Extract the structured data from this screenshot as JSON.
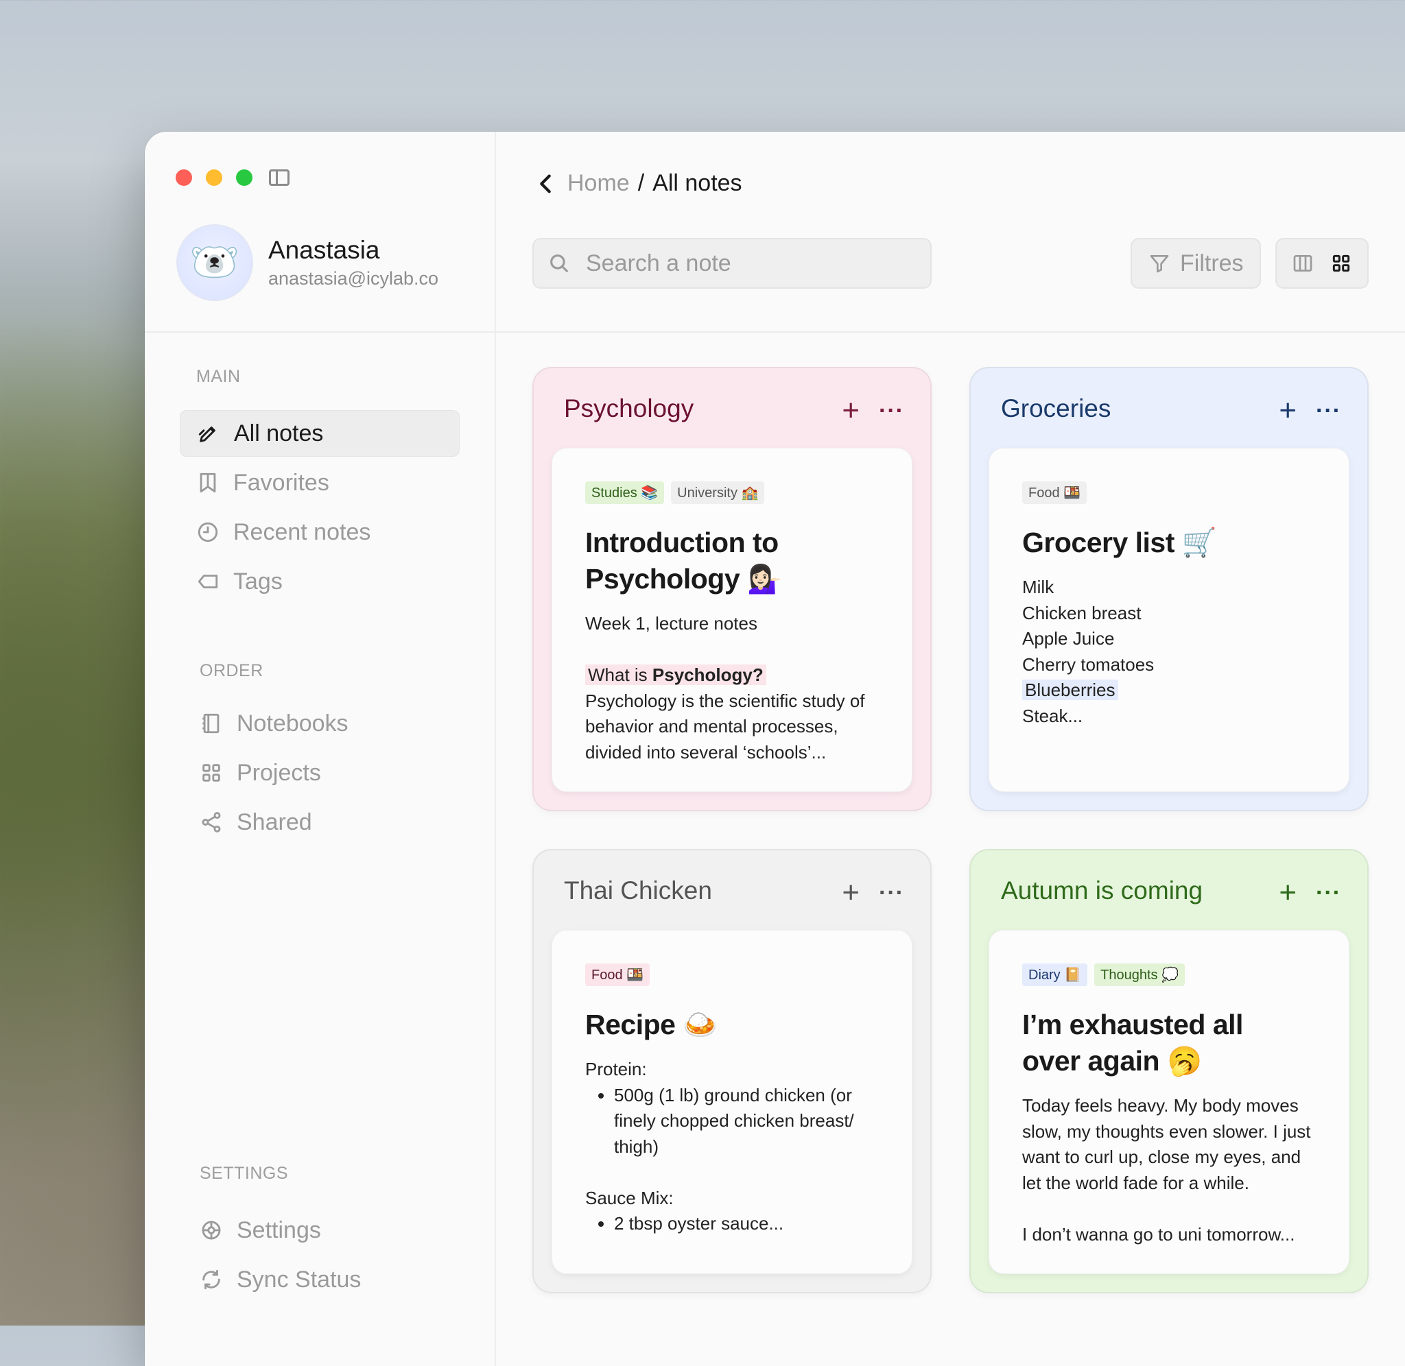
{
  "window": {
    "controls": [
      "close",
      "minimize",
      "zoom"
    ]
  },
  "profile": {
    "avatar_emoji": "🐻‍❄️",
    "name": "Anastasia",
    "email": "anastasia@icylab.co"
  },
  "sidebar": {
    "main_label": "MAIN",
    "main_items": [
      {
        "label": "All notes",
        "icon": "pencil-icon",
        "active": true
      },
      {
        "label": "Favorites",
        "icon": "bookmark-icon",
        "active": false
      },
      {
        "label": "Recent notes",
        "icon": "clock-icon",
        "active": false
      },
      {
        "label": "Tags",
        "icon": "tag-icon",
        "active": false
      }
    ],
    "order_label": "ORDER",
    "order_items": [
      {
        "label": "Notebooks",
        "icon": "notebook-icon"
      },
      {
        "label": "Projects",
        "icon": "grid-icon"
      },
      {
        "label": "Shared",
        "icon": "share-icon"
      }
    ],
    "settings_label": "SETTINGS",
    "settings_items": [
      {
        "label": "Settings",
        "icon": "gear-icon"
      },
      {
        "label": "Sync Status",
        "icon": "sync-icon"
      }
    ]
  },
  "header": {
    "breadcrumb_home": "Home",
    "breadcrumb_separator": "/",
    "breadcrumb_current": "All notes",
    "search_placeholder": "Search a note",
    "filters_label": "Filtres"
  },
  "colors": {
    "psychology": "#fbe8ef",
    "groceries": "#e9effd",
    "thai_chicken": "#f1f1f1",
    "autumn": "#e5f6dc"
  },
  "notebooks": {
    "psychology": {
      "title": "Psychology",
      "tags": [
        "Studies 📚",
        "University 🏫"
      ],
      "note_title_line1": "Introduction to",
      "note_title_line2": "Psychology 💁🏻‍♀️",
      "subtitle": "Week 1, lecture notes",
      "highlight_prefix": "What is ",
      "highlight_bold": "Psychology?",
      "body": "Psychology is the scientific study of behavior and mental processes, divided into several ‘schools’..."
    },
    "groceries": {
      "title": "Groceries",
      "tags": [
        "Food 🍱"
      ],
      "note_title": "Grocery list 🛒",
      "items": [
        "Milk",
        "Chicken breast",
        "Apple Juice",
        "Cherry tomatoes",
        "Blueberries",
        "Steak..."
      ]
    },
    "thai_chicken": {
      "title": "Thai Chicken",
      "tags": [
        "Food 🍱"
      ],
      "note_title": "Recipe 🍛",
      "protein_label": "Protein:",
      "protein_item": "500g (1 lb) ground chicken (or finely chopped chicken breast/ thigh)",
      "sauce_label": "Sauce Mix:",
      "sauce_item": "2 tbsp oyster sauce..."
    },
    "autumn": {
      "title": "Autumn is coming",
      "tags": [
        "Diary 📔",
        "Thoughts 💭"
      ],
      "note_title_line1": "I’m exhausted all",
      "note_title_line2": "over again 🥱",
      "body1": "Today feels heavy. My body moves slow, my thoughts even slower. I just want to curl up, close my eyes, and let the world fade for a while.",
      "body2": "I don’t wanna go to uni tomorrow..."
    }
  }
}
